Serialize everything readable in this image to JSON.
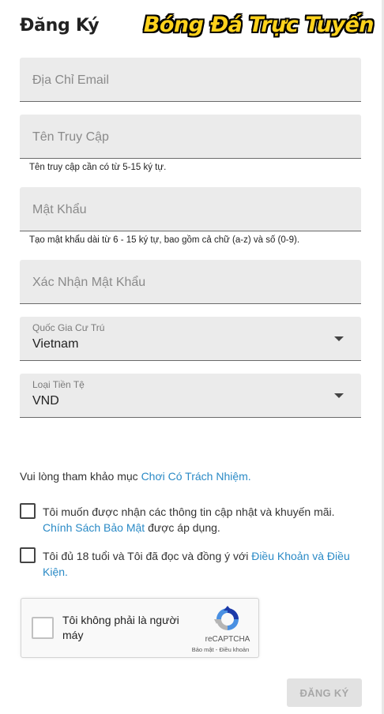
{
  "header": {
    "title": "Đăng Ký",
    "watermark": "Bóng Đá Trực Tuyến"
  },
  "form": {
    "email": {
      "placeholder": "Địa Chỉ Email"
    },
    "username": {
      "placeholder": "Tên Truy Cập",
      "hint": "Tên truy cập cần có từ 5-15 ký tự."
    },
    "password": {
      "placeholder": "Mật Khẩu",
      "hint": "Tạo mật khẩu dài từ 6 - 15 ký tự, bao gồm cả chữ (a-z) và số (0-9)."
    },
    "confirm_password": {
      "placeholder": "Xác Nhận Mật Khẩu"
    },
    "country": {
      "label": "Quốc Gia Cư Trú",
      "value": "Vietnam"
    },
    "currency": {
      "label": "Loại Tiền Tệ",
      "value": "VND"
    }
  },
  "responsible": {
    "text": "Vui lòng tham khảo mục ",
    "link": "Chơi Có Trách Nhiệm."
  },
  "consent_marketing": {
    "text": "Tôi muốn được nhận các thông tin cập nhật và khuyến mãi.",
    "link": "Chính Sách Bảo Mật",
    "suffix": " được áp dụng."
  },
  "consent_age": {
    "text": "Tôi đủ 18 tuổi và Tôi đã đọc và đồng ý với ",
    "link": "Điều Khoản và Điều Kiện."
  },
  "recaptcha": {
    "label": "Tôi không phải là người máy",
    "brand": "reCAPTCHA",
    "links": "Bảo mật - Điều khoản"
  },
  "submit_label": "ĐĂNG KÝ",
  "colors": {
    "link": "#2a8ac6",
    "field_bg": "#ebebeb",
    "watermark": "#ffd21c",
    "submit_bg": "#e2e2e2"
  }
}
